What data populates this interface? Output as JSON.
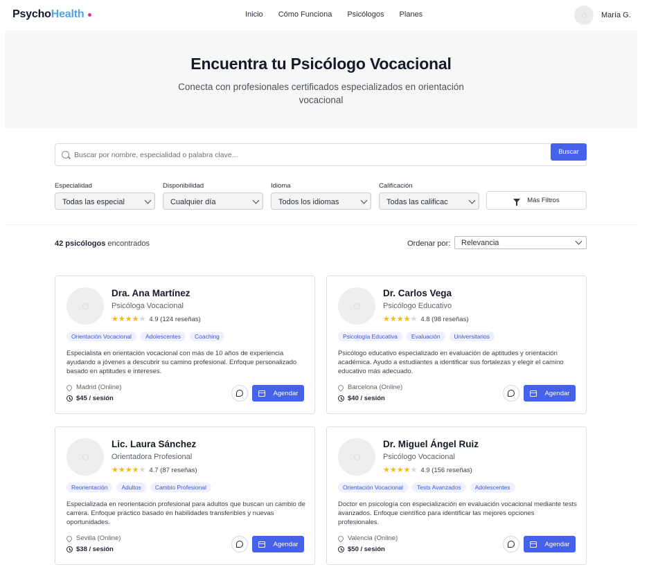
{
  "header": {
    "logo_part1": "Psycho",
    "logo_part2": "Health",
    "nav": [
      "Inicio",
      "Cómo Funciona",
      "Psicólogos",
      "Planes"
    ],
    "user_name": "María G."
  },
  "hero": {
    "title": "Encuentra tu Psicólogo Vocacional",
    "subtitle": "Conecta con profesionales certificados especializados en orientación vocacional"
  },
  "search": {
    "placeholder": "Buscar por nombre, especialidad o palabra clave...",
    "button": "Buscar"
  },
  "filters": [
    {
      "label": "Especialidad",
      "value": "Todas las especial"
    },
    {
      "label": "Disponibilidad",
      "value": "Cualquier día"
    },
    {
      "label": "Idioma",
      "value": "Todos los idiomas"
    },
    {
      "label": "Calificación",
      "value": "Todas las calificac"
    }
  ],
  "more_filters": "Más Filtros",
  "results": {
    "count_bold": "42 psicólogos",
    "count_rest": " encontrados",
    "sort_label": "Ordenar por:",
    "sort_value": "Relevancia"
  },
  "actions": {
    "book": "Agendar"
  },
  "psychologists": [
    {
      "name": "Dra. Ana Martínez",
      "role": "Psicóloga Vocacional",
      "rating": 4.9,
      "rating_text": "4.9 (124 reseñas)",
      "tags": [
        "Orientación Vocacional",
        "Adolescentes",
        "Coaching"
      ],
      "description": "Especialista en orientación vocacional con más de 10 años de experiencia ayudando a jóvenes a descubrir su camino profesional. Enfoque personalizado basado en aptitudes e intereses.",
      "location": "Madrid (Online)",
      "price": "$45 / sesión"
    },
    {
      "name": "Dr. Carlos Vega",
      "role": "Psicólogo Educativo",
      "rating": 4.8,
      "rating_text": "4.8 (98 reseñas)",
      "tags": [
        "Psicología Educativa",
        "Evaluación",
        "Universitarios"
      ],
      "description": "Psicólogo educativo especializado en evaluación de aptitudes y orientación académica. Ayudo a estudiantes a identificar sus fortalezas y elegir el camino educativo más adecuado.",
      "location": "Barcelona (Online)",
      "price": "$40 / sesión"
    },
    {
      "name": "Lic. Laura Sánchez",
      "role": "Orientadora Profesional",
      "rating": 4.7,
      "rating_text": "4.7 (87 reseñas)",
      "tags": [
        "Reorientación",
        "Adultos",
        "Cambio Profesional"
      ],
      "description": "Especializada en reorientación profesional para adultos que buscan un cambio de carrera. Enfoque práctico basado en habilidades transferibles y nuevas oportunidades.",
      "location": "Sevilla (Online)",
      "price": "$38 / sesión"
    },
    {
      "name": "Dr. Miguel Ángel Ruiz",
      "role": "Psicólogo Vocacional",
      "rating": 4.9,
      "rating_text": "4.9 (156 reseñas)",
      "tags": [
        "Orientación Vocacional",
        "Tests Avanzados",
        "Adolescentes"
      ],
      "description": "Doctor en psicología con especialización en evaluación vocacional mediante tests avanzados. Enfoque científico para identificar las mejores opciones profesionales.",
      "location": "Valencia (Online)",
      "price": "$50 / sesión"
    }
  ],
  "colors": {
    "accent": "#4661ea",
    "logo_blue": "#4fa3e8",
    "logo_dot": "#e8318a",
    "star": "#f5b90a",
    "tag_bg": "#eef1fd",
    "tag_text": "#3a56d6"
  },
  "icons": [
    "search-icon",
    "chevron-down-icon",
    "funnel-icon",
    "map-pin-icon",
    "clock-icon",
    "chat-icon",
    "calendar-icon",
    "star-icon"
  ]
}
